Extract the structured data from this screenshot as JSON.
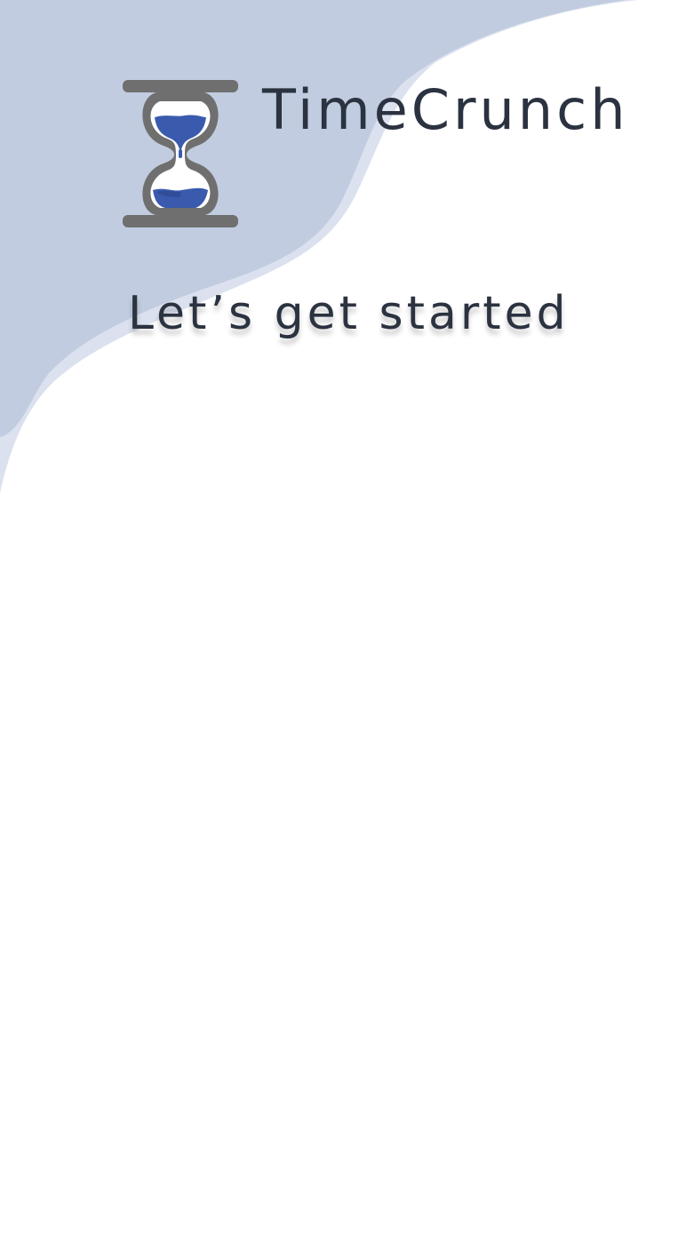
{
  "app": {
    "title": "TimeCrunch",
    "logo_icon": "hourglass-icon"
  },
  "welcome": {
    "tagline": "Let’s get started"
  },
  "colors": {
    "text": "#2b3240",
    "wave_dark": "#c1cce0",
    "wave_light": "#dbe1ee",
    "hourglass_frame": "#6f6f6f",
    "sand": "#3a5aad",
    "background": "#ffffff"
  }
}
